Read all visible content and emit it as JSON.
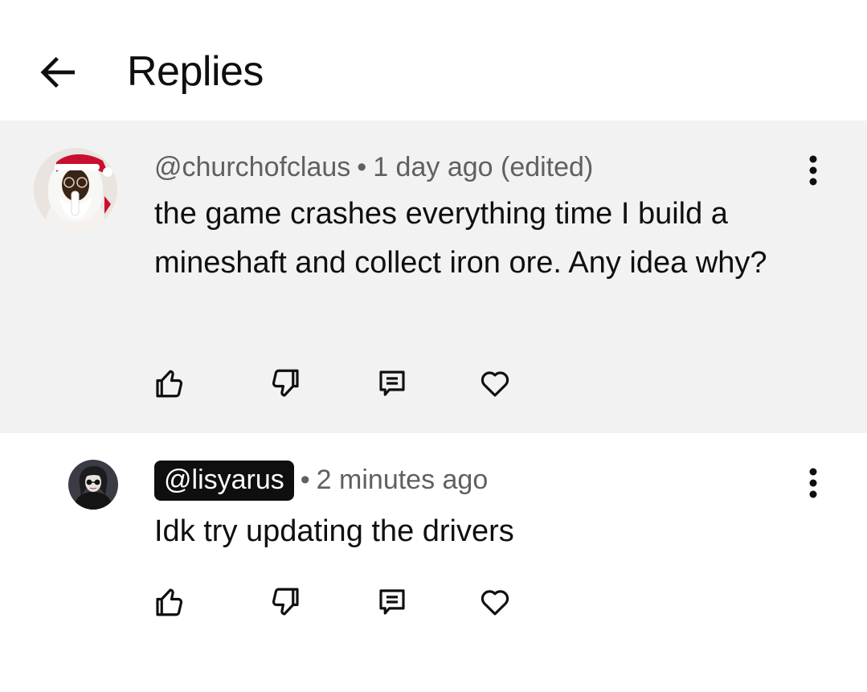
{
  "header": {
    "back_icon": "arrow-left-icon",
    "title": "Replies"
  },
  "parent_comment": {
    "author": "@churchofclaus",
    "separator": "•",
    "time": "1 day ago (edited)",
    "body": "the game crashes everything time I build a mineshaft and collect iron ore. Any idea why?",
    "actions": [
      "thumbs-up-icon",
      "thumbs-down-icon",
      "reply-icon",
      "heart-icon"
    ],
    "more_icon": "more-vert-icon"
  },
  "reply_comment": {
    "author": "@lisyarus",
    "separator": "•",
    "time": "2 minutes ago",
    "body": "Idk try updating the drivers",
    "actions": [
      "thumbs-up-icon",
      "thumbs-down-icon",
      "reply-icon",
      "heart-icon"
    ],
    "more_icon": "more-vert-icon"
  },
  "colors": {
    "highlight_background": "#f2f2f2",
    "text_primary": "#0f0f0f",
    "text_secondary": "#606060",
    "author_chip_background": "#0f0f0f"
  }
}
